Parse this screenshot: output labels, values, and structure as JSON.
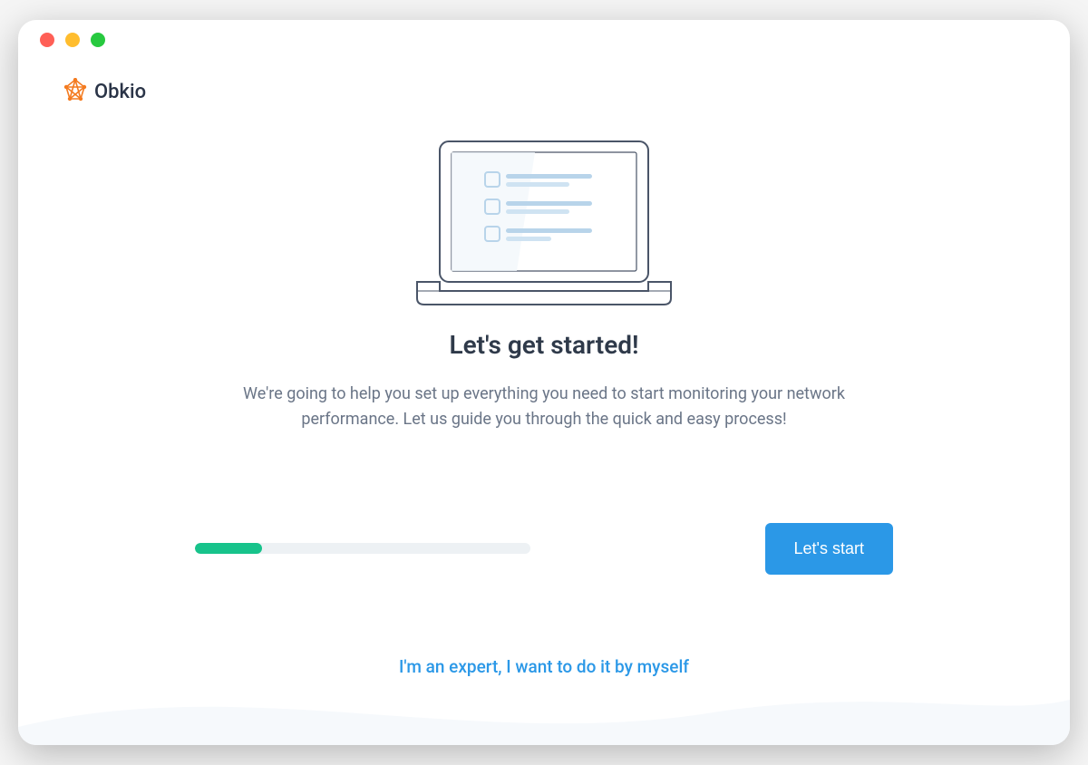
{
  "brand": {
    "name": "Obkio"
  },
  "onboarding": {
    "headline": "Let's get started!",
    "description": "We're going to help you set up everything you need to start monitoring your network performance. Let us guide you through the quick and easy process!",
    "progress_percent": 20,
    "start_button_label": "Let's start",
    "expert_link_label": "I'm an expert, I want to do it by myself"
  },
  "colors": {
    "accent": "#2b98e7",
    "progress_fill": "#17c38b",
    "text_primary": "#2f3a4a",
    "text_secondary": "#6a7587"
  }
}
